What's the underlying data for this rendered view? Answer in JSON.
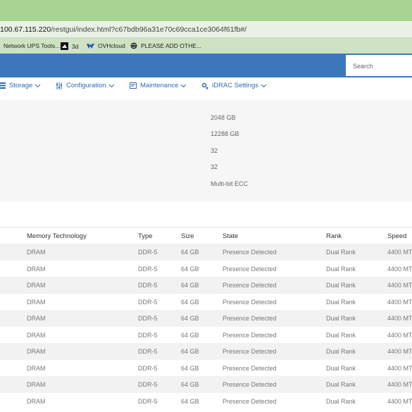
{
  "browser": {
    "url_host": "100.67.115.220",
    "url_path": "/restgui/index.html?c67bdb96a31e70c69cca1ce3064f61fb#/",
    "bookmarks": [
      {
        "label": "Network UPS Tools...",
        "icon": "globe-icon"
      },
      {
        "label": "3d",
        "icon": "3d-icon"
      },
      {
        "label": "OVHcloud",
        "icon": "ovhcloud-icon"
      },
      {
        "label": "PLEASE ADD OTHE...",
        "icon": "globe-icon"
      }
    ]
  },
  "header": {
    "search_placeholder": "Search",
    "colors": {
      "header": "#3c77bb",
      "titlebar": "#a9d392",
      "link": "#2f6bb2"
    }
  },
  "menu": [
    {
      "label": "Storage",
      "icon": "storage-icon"
    },
    {
      "label": "Configuration",
      "icon": "sliders-icon"
    },
    {
      "label": "Maintenance",
      "icon": "maintenance-icon"
    },
    {
      "label": "iDRAC Settings",
      "icon": "gear-icon"
    }
  ],
  "summary": {
    "values": [
      "2048 GB",
      "12288 GB",
      "32",
      "32",
      "Multi-bit ECC"
    ]
  },
  "table": {
    "columns": [
      "Memory Technology",
      "Type",
      "Size",
      "State",
      "Rank",
      "Speed"
    ],
    "rows": [
      [
        "DRAM",
        "DDR-5",
        "64 GB",
        "Presence Detected",
        "Dual Rank",
        "4400 MT"
      ],
      [
        "DRAM",
        "DDR-5",
        "64 GB",
        "Presence Detected",
        "Dual Rank",
        "4400 MT"
      ],
      [
        "DRAM",
        "DDR-5",
        "64 GB",
        "Presence Detected",
        "Dual Rank",
        "4400 MT"
      ],
      [
        "DRAM",
        "DDR-5",
        "64 GB",
        "Presence Detected",
        "Dual Rank",
        "4400 MT"
      ],
      [
        "DRAM",
        "DDR-5",
        "64 GB",
        "Presence Detected",
        "Dual Rank",
        "4400 MT"
      ],
      [
        "DRAM",
        "DDR-5",
        "64 GB",
        "Presence Detected",
        "Dual Rank",
        "4400 MT"
      ],
      [
        "DRAM",
        "DDR-5",
        "64 GB",
        "Presence Detected",
        "Dual Rank",
        "4400 MT"
      ],
      [
        "DRAM",
        "DDR-5",
        "64 GB",
        "Presence Detected",
        "Dual Rank",
        "4400 MT"
      ],
      [
        "DRAM",
        "DDR-5",
        "64 GB",
        "Presence Detected",
        "Dual Rank",
        "4400 MT"
      ],
      [
        "DRAM",
        "DDR-5",
        "64 GB",
        "Presence Detected",
        "Dual Rank",
        "4400 MT"
      ]
    ]
  }
}
